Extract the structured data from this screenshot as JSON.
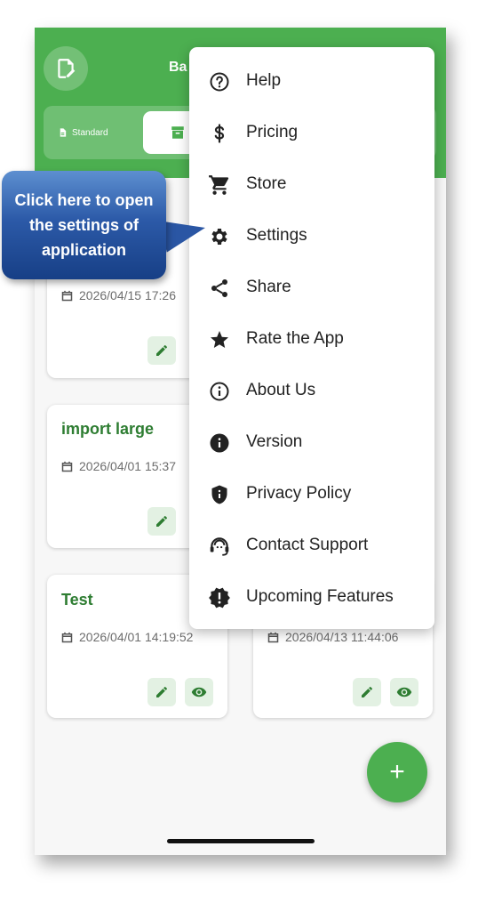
{
  "header": {
    "title_fragment": "Ba",
    "tabs": {
      "standard_label": "Standard"
    }
  },
  "cards": [
    {
      "title": "",
      "date": "2026/04/15 17:26"
    },
    {
      "title": "import large",
      "date": "2026/04/01 15:37"
    },
    {
      "title": "Test",
      "date": "2026/04/01 14:19:52"
    },
    {
      "title": "",
      "date": "2026/04/13 11:44:06"
    }
  ],
  "menu": {
    "items": [
      {
        "label": "Help",
        "icon": "help-circle-icon"
      },
      {
        "label": "Pricing",
        "icon": "dollar-icon"
      },
      {
        "label": "Store",
        "icon": "cart-icon"
      },
      {
        "label": "Settings",
        "icon": "gear-icon"
      },
      {
        "label": "Share",
        "icon": "share-icon"
      },
      {
        "label": "Rate the App",
        "icon": "star-icon"
      },
      {
        "label": "About Us",
        "icon": "info-outline-icon"
      },
      {
        "label": "Version",
        "icon": "info-filled-icon"
      },
      {
        "label": "Privacy Policy",
        "icon": "shield-icon"
      },
      {
        "label": "Contact Support",
        "icon": "support-agent-icon"
      },
      {
        "label": "Upcoming Features",
        "icon": "new-releases-icon"
      }
    ]
  },
  "callout": {
    "text": "Click here to open the settings of application"
  },
  "fab": {
    "symbol": "+"
  },
  "colors": {
    "primary": "#4caf50",
    "card_title": "#2e7d32",
    "callout_blue": "#2c5aa8"
  }
}
